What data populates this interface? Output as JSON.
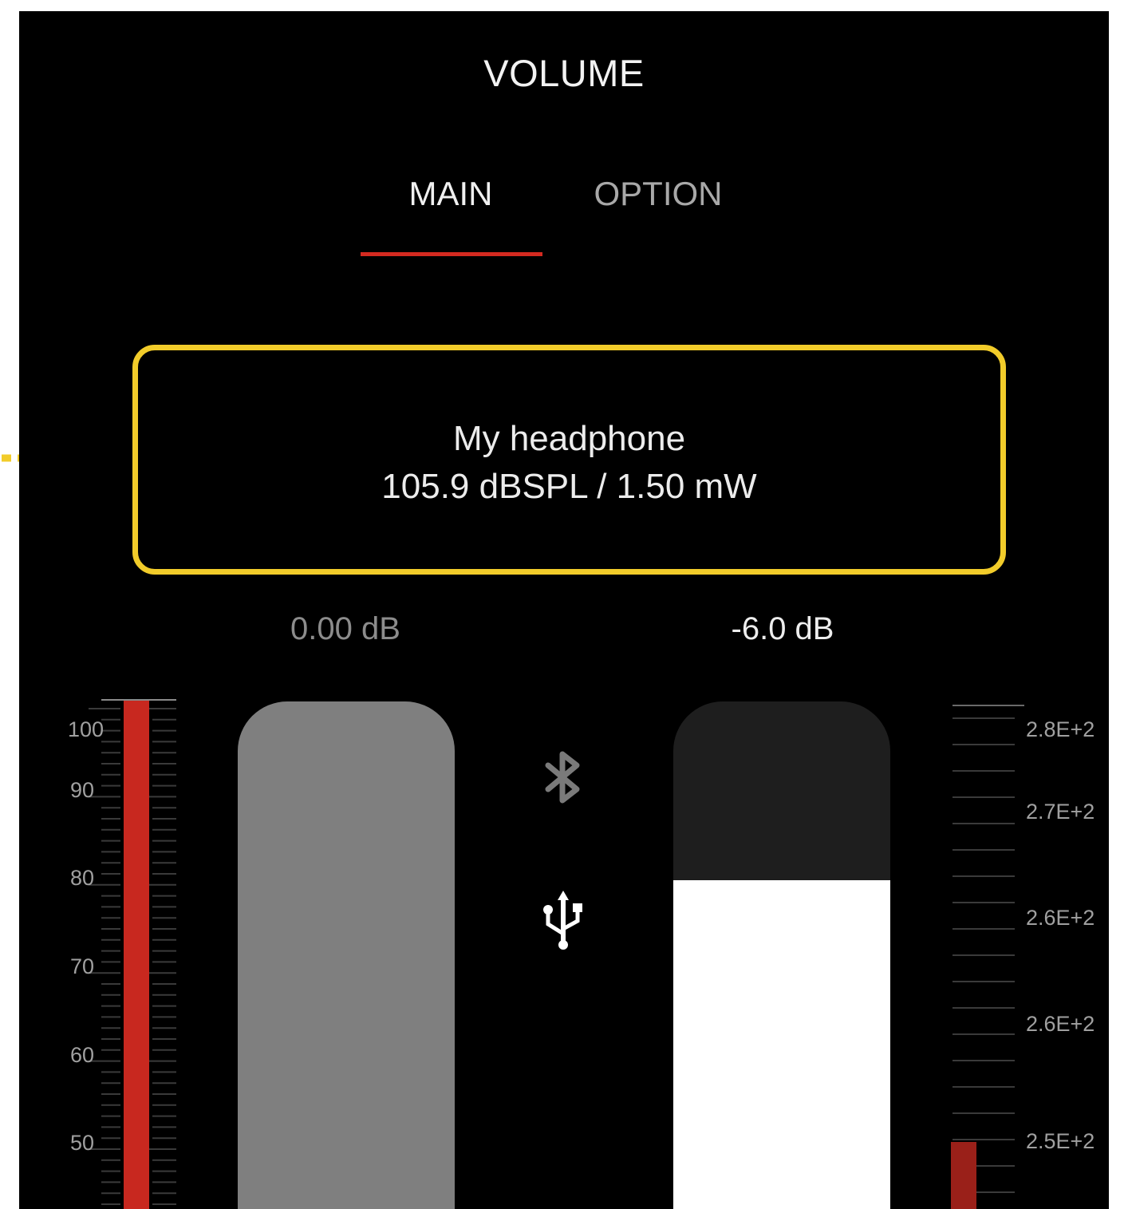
{
  "header": {
    "title": "VOLUME"
  },
  "tabs": [
    {
      "label": "MAIN",
      "active": true
    },
    {
      "label": "OPTION",
      "active": false
    }
  ],
  "device": {
    "name": "My headphone",
    "spec": "105.9 dBSPL / 1.50 mW"
  },
  "faders": {
    "left": {
      "value_label": "0.00 dB",
      "level": 1.0
    },
    "right": {
      "value_label": "-6.0 dB",
      "level": 0.68
    }
  },
  "meters": {
    "left": {
      "ticks": [
        "100",
        "90",
        "80",
        "70",
        "60",
        "50"
      ]
    },
    "right": {
      "ticks": [
        "2.8E+2",
        "2.7E+2",
        "2.6E+2",
        "2.6E+2",
        "2.5E+2"
      ]
    }
  },
  "icons": {
    "bluetooth": "bluetooth-icon",
    "usb": "usb-icon",
    "callout": "dotted-arrow-icon"
  },
  "colors": {
    "background": "#000000",
    "accent": "#d42a20",
    "highlight_border": "#f2cc2a",
    "fader_inactive": "#7f7f7f",
    "fader_active": "#ffffff"
  }
}
